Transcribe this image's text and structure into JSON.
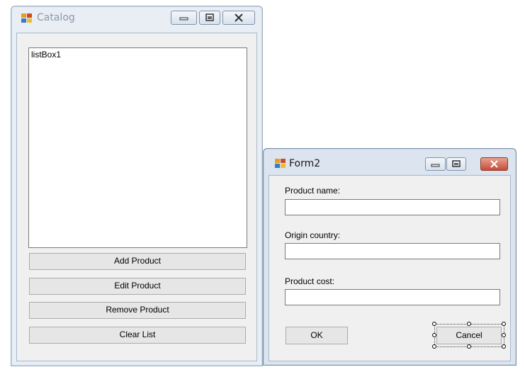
{
  "catalog": {
    "title": "Catalog",
    "listbox_text": "listBox1",
    "buttons": {
      "add": "Add Product",
      "edit": "Edit Product",
      "remove": "Remove Product",
      "clear": "Clear List"
    }
  },
  "form2": {
    "title": "Form2",
    "fields": {
      "name_label": "Product name:",
      "name_value": "",
      "country_label": "Origin country:",
      "country_value": "",
      "cost_label": "Product cost:",
      "cost_value": ""
    },
    "ok_label": "OK",
    "cancel_label": "Cancel",
    "selected_control": "cancel-button"
  },
  "icons": {
    "app": "windows-form-icon",
    "minimize": "minimize-icon",
    "maximize": "maximize-icon",
    "close": "close-icon"
  },
  "colors": {
    "close_active": "#c64b35",
    "title_inactive": "#8b98a8"
  }
}
